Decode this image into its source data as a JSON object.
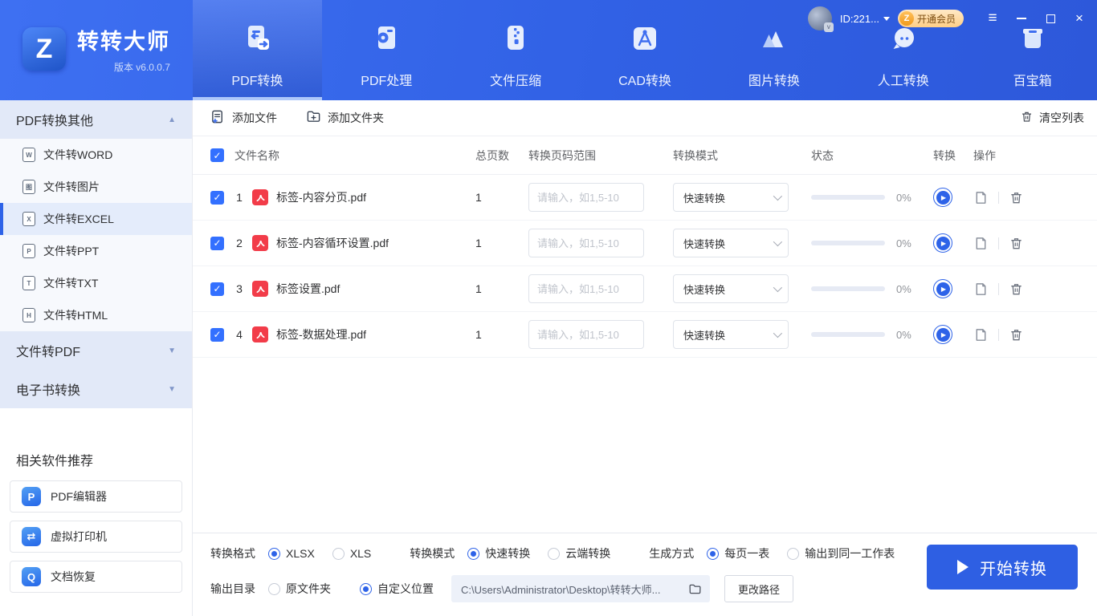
{
  "brand": {
    "name": "转转大师",
    "version": "版本 v6.0.0.7",
    "logo_letter": "Z"
  },
  "userbar": {
    "id": "ID:221...",
    "vip": "开通会员",
    "vip_coin": "Z"
  },
  "nav": {
    "tabs": [
      {
        "label": "PDF转换",
        "active": true
      },
      {
        "label": "PDF处理",
        "active": false
      },
      {
        "label": "文件压缩",
        "active": false
      },
      {
        "label": "CAD转换",
        "active": false
      },
      {
        "label": "图片转换",
        "active": false
      },
      {
        "label": "人工转换",
        "active": false
      },
      {
        "label": "百宝箱",
        "active": false
      }
    ]
  },
  "sidebar": {
    "sections": [
      {
        "label": "PDF转换其他",
        "expanded": true,
        "items": [
          {
            "label": "文件转WORD",
            "icon": "W",
            "selected": false
          },
          {
            "label": "文件转图片",
            "icon": "图",
            "selected": false
          },
          {
            "label": "文件转EXCEL",
            "icon": "X",
            "selected": true
          },
          {
            "label": "文件转PPT",
            "icon": "P",
            "selected": false
          },
          {
            "label": "文件转TXT",
            "icon": "T",
            "selected": false
          },
          {
            "label": "文件转HTML",
            "icon": "H",
            "selected": false
          }
        ]
      },
      {
        "label": "文件转PDF",
        "expanded": false
      },
      {
        "label": "电子书转换",
        "expanded": false
      }
    ],
    "promo": {
      "title": "相关软件推荐",
      "items": [
        {
          "label": "PDF编辑器",
          "glyph": "P"
        },
        {
          "label": "虚拟打印机",
          "glyph": "⇄"
        },
        {
          "label": "文档恢复",
          "glyph": "Q"
        }
      ]
    }
  },
  "toolbar": {
    "add_file": "添加文件",
    "add_folder": "添加文件夹",
    "clear": "清空列表"
  },
  "table": {
    "select_all": true,
    "headers": {
      "name": "文件名称",
      "pages": "总页数",
      "range": "转换页码范围",
      "mode": "转换模式",
      "status": "状态",
      "convert": "转换",
      "ops": "操作"
    },
    "range_placeholder": "请输入，如1,5-10",
    "rows": [
      {
        "index": "1",
        "filename": "标签-内容分页.pdf",
        "pages": "1",
        "mode": "快速转换",
        "progress": "0%",
        "checked": true
      },
      {
        "index": "2",
        "filename": "标签-内容循环设置.pdf",
        "pages": "1",
        "mode": "快速转换",
        "progress": "0%",
        "checked": true
      },
      {
        "index": "3",
        "filename": "标签设置.pdf",
        "pages": "1",
        "mode": "快速转换",
        "progress": "0%",
        "checked": true
      },
      {
        "index": "4",
        "filename": "标签-数据处理.pdf",
        "pages": "1",
        "mode": "快速转换",
        "progress": "0%",
        "checked": true
      }
    ]
  },
  "settings": {
    "format": {
      "label": "转换格式",
      "options": [
        {
          "label": "XLSX",
          "selected": true
        },
        {
          "label": "XLS",
          "selected": false
        }
      ]
    },
    "mode": {
      "label": "转换模式",
      "options": [
        {
          "label": "快速转换",
          "selected": true
        },
        {
          "label": "云端转换",
          "selected": false
        }
      ]
    },
    "gen": {
      "label": "生成方式",
      "options": [
        {
          "label": "每页一表",
          "selected": true
        },
        {
          "label": "输出到同一工作表",
          "selected": false
        }
      ]
    },
    "output": {
      "label": "输出目录",
      "options": [
        {
          "label": "原文件夹",
          "selected": false
        },
        {
          "label": "自定义位置",
          "selected": true
        }
      ],
      "path": "C:\\Users\\Administrator\\Desktop\\转转大师...",
      "change": "更改路径"
    }
  },
  "start": {
    "label": "开始转换"
  },
  "colors": {
    "accent": "#2e63e8",
    "header_blue": "#3161e5",
    "pdf_red": "#f23c49",
    "vip_orange": "#f09a1c"
  }
}
